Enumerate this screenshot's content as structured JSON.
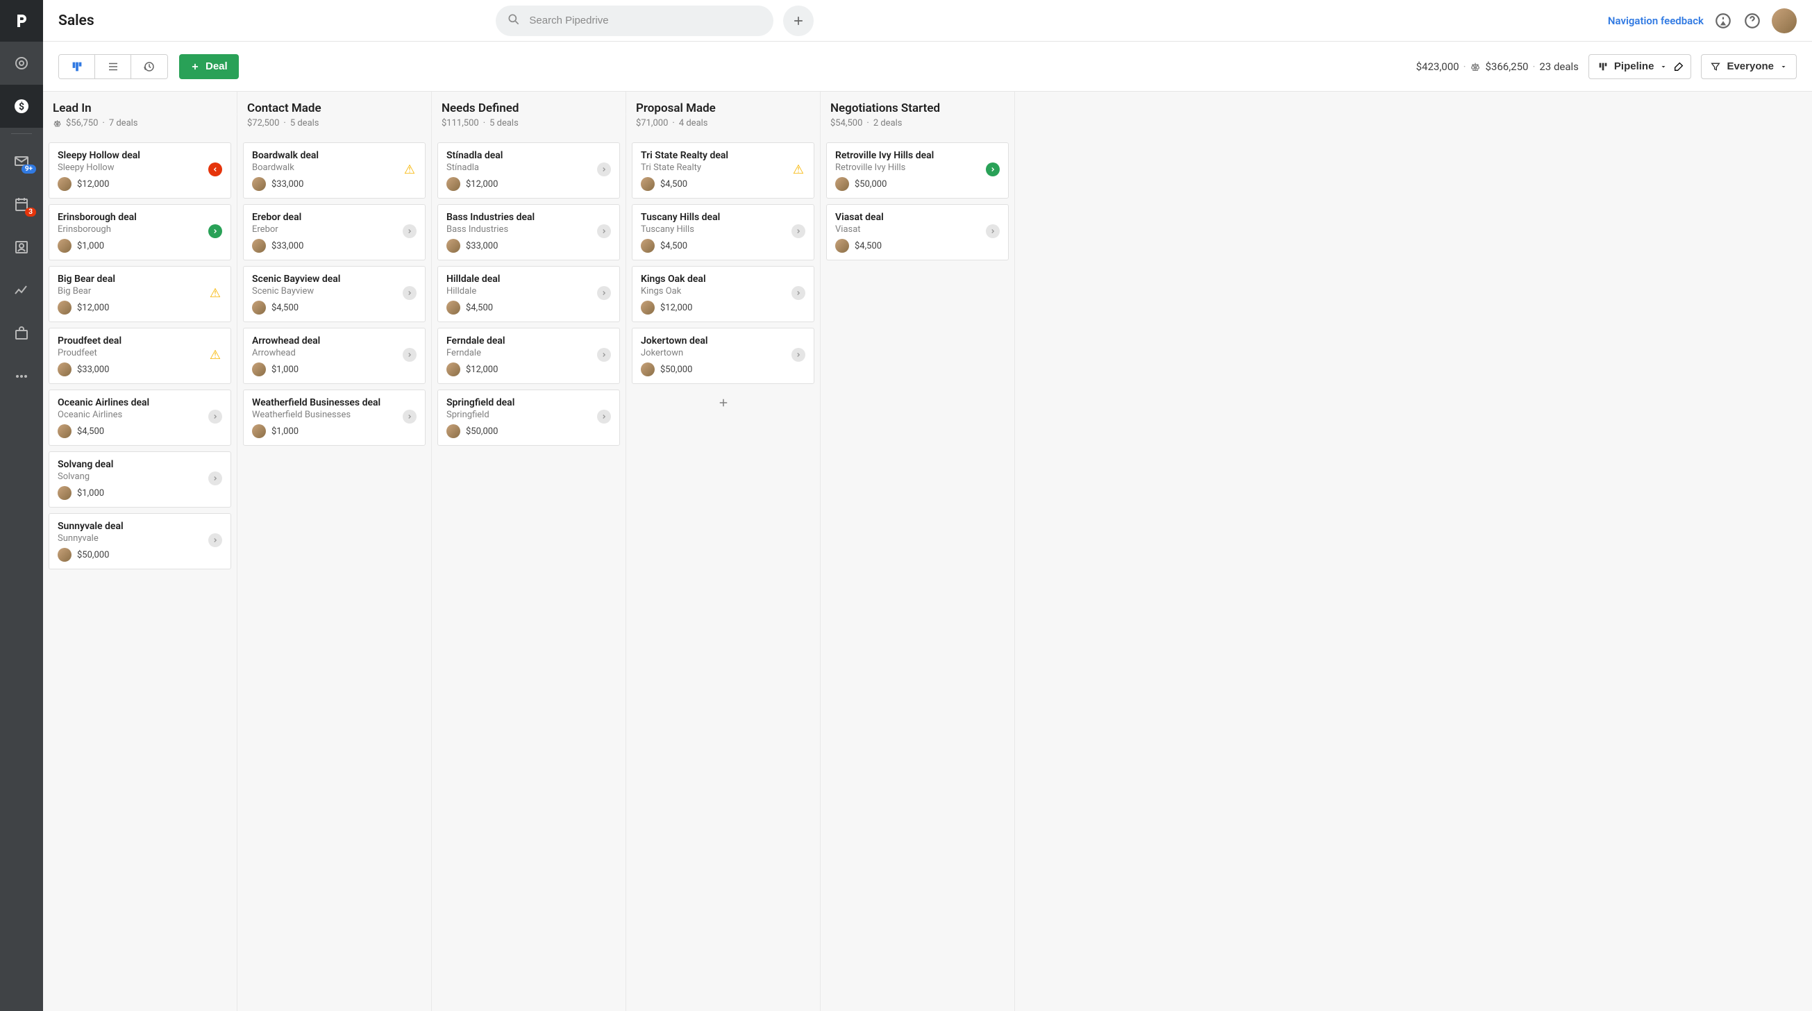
{
  "header": {
    "title": "Sales",
    "search_placeholder": "Search Pipedrive",
    "nav_feedback": "Navigation feedback"
  },
  "sidebar": {
    "mail_badge": "9+",
    "calendar_badge": "3"
  },
  "toolbar": {
    "deal_label": "Deal",
    "total": "$423,000",
    "weighted": "$366,250",
    "deal_count": "23 deals",
    "pipeline_label": "Pipeline",
    "filter_label": "Everyone"
  },
  "columns": [
    {
      "title": "Lead In",
      "amount": "$56,750",
      "count": "7 deals",
      "show_scale": true,
      "cards": [
        {
          "title": "Sleepy Hollow deal",
          "org": "Sleepy Hollow",
          "value": "$12,000",
          "status": "red"
        },
        {
          "title": "Erinsborough deal",
          "org": "Erinsborough",
          "value": "$1,000",
          "status": "green"
        },
        {
          "title": "Big Bear deal",
          "org": "Big Bear",
          "value": "$12,000",
          "status": "yellow"
        },
        {
          "title": "Proudfeet deal",
          "org": "Proudfeet",
          "value": "$33,000",
          "status": "yellow"
        },
        {
          "title": "Oceanic Airlines deal",
          "org": "Oceanic Airlines",
          "value": "$4,500",
          "status": "gray"
        },
        {
          "title": "Solvang deal",
          "org": "Solvang",
          "value": "$1,000",
          "status": "gray"
        },
        {
          "title": "Sunnyvale deal",
          "org": "Sunnyvale",
          "value": "$50,000",
          "status": "gray"
        }
      ]
    },
    {
      "title": "Contact Made",
      "amount": "$72,500",
      "count": "5 deals",
      "cards": [
        {
          "title": "Boardwalk deal",
          "org": "Boardwalk",
          "value": "$33,000",
          "status": "yellow"
        },
        {
          "title": "Erebor deal",
          "org": "Erebor",
          "value": "$33,000",
          "status": "gray"
        },
        {
          "title": "Scenic Bayview deal",
          "org": "Scenic Bayview",
          "value": "$4,500",
          "status": "gray"
        },
        {
          "title": "Arrowhead deal",
          "org": "Arrowhead",
          "value": "$1,000",
          "status": "gray"
        },
        {
          "title": "Weatherfield Businesses deal",
          "org": "Weatherfield Businesses",
          "value": "$1,000",
          "status": "gray"
        }
      ]
    },
    {
      "title": "Needs Defined",
      "amount": "$111,500",
      "count": "5 deals",
      "cards": [
        {
          "title": "Stínadla deal",
          "org": "Stínadla",
          "value": "$12,000",
          "status": "gray"
        },
        {
          "title": "Bass Industries deal",
          "org": "Bass Industries",
          "value": "$33,000",
          "status": "gray"
        },
        {
          "title": "Hilldale deal",
          "org": "Hilldale",
          "value": "$4,500",
          "status": "gray"
        },
        {
          "title": "Ferndale deal",
          "org": "Ferndale",
          "value": "$12,000",
          "status": "gray"
        },
        {
          "title": "Springfield deal",
          "org": "Springfield",
          "value": "$50,000",
          "status": "gray"
        }
      ]
    },
    {
      "title": "Proposal Made",
      "amount": "$71,000",
      "count": "4 deals",
      "cards": [
        {
          "title": "Tri State Realty deal",
          "org": "Tri State Realty",
          "value": "$4,500",
          "status": "yellow"
        },
        {
          "title": "Tuscany Hills deal",
          "org": "Tuscany Hills",
          "value": "$4,500",
          "status": "gray"
        },
        {
          "title": "Kings Oak deal",
          "org": "Kings Oak",
          "value": "$12,000",
          "status": "gray"
        },
        {
          "title": "Jokertown deal",
          "org": "Jokertown",
          "value": "$50,000",
          "status": "gray"
        }
      ],
      "show_add": true
    },
    {
      "title": "Negotiations Started",
      "amount": "$54,500",
      "count": "2 deals",
      "cards": [
        {
          "title": "Retroville Ivy Hills deal",
          "org": "Retroville Ivy Hills",
          "value": "$50,000",
          "status": "green"
        },
        {
          "title": "Viasat deal",
          "org": "Viasat",
          "value": "$4,500",
          "status": "gray"
        }
      ]
    }
  ]
}
